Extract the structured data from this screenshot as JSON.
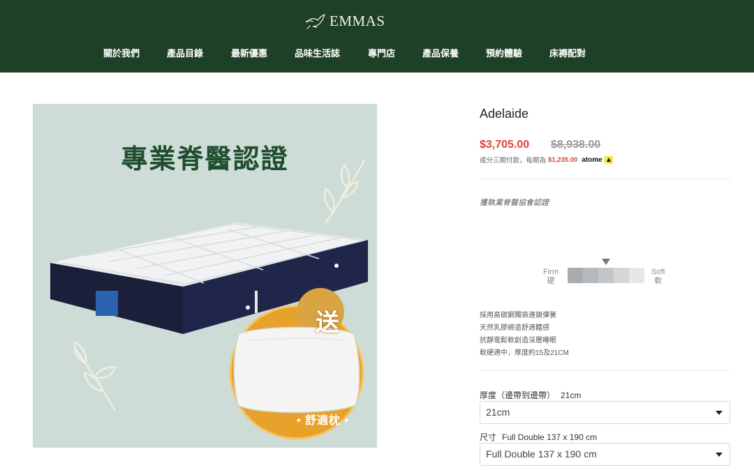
{
  "header": {
    "logo_text": "EMMAS",
    "nav": [
      {
        "label": "關於我們"
      },
      {
        "label": "產品目錄"
      },
      {
        "label": "最新優惠"
      },
      {
        "label": "品味生活誌"
      },
      {
        "label": "專門店"
      },
      {
        "label": "產品保養"
      },
      {
        "label": "預約體驗"
      },
      {
        "label": "床褥配對"
      }
    ]
  },
  "promo": {
    "title": "專業脊醫認證",
    "gift": "送",
    "pillow": "• 舒適枕 •"
  },
  "product": {
    "name": "Adelaide",
    "price_sale": "$3,705.00",
    "price_original": "$8,938.00",
    "installment_text": "或分三期付款，每期為",
    "installment_amount": "$1,235.00",
    "installment_provider": "atome",
    "certification": "獲執業脊醫協會認證",
    "firmness": {
      "firm_en": "Firm",
      "firm_zh": "硬",
      "soft_en": "Soft",
      "soft_zh": "軟",
      "level_percent": 50,
      "scale_colors": [
        "#a8acaf",
        "#b6babd",
        "#c3c6c9",
        "#d4d6d8",
        "#e6e7e8"
      ]
    },
    "features": [
      "採用高碳鋼獨袋連鎖彈簧",
      "天然乳膠締造舒適體感",
      "抗靜電鬆軟創造深層睡眠",
      "軟硬適中，厚度約15及21CM"
    ],
    "options": {
      "thickness": {
        "label": "厚度（邊帶到邊帶）",
        "value": "21cm",
        "selected": "21cm"
      },
      "size": {
        "label": "尺寸",
        "value": "Full Double 137 x 190 cm",
        "selected": "Full Double 137 x 190 cm"
      }
    }
  },
  "colors": {
    "header_bg": "#1e4027",
    "sale_price": "#e0413a",
    "image_bg": "#cddcd6"
  }
}
